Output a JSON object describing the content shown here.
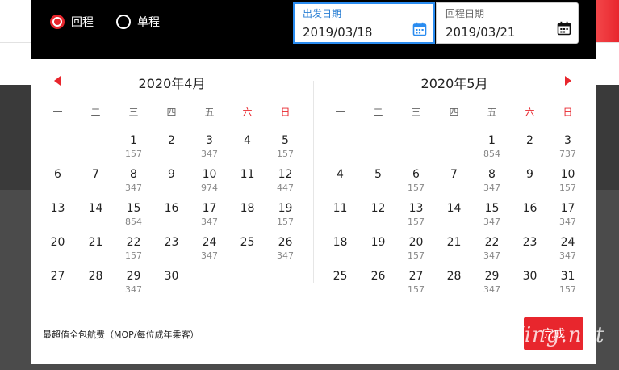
{
  "trip_type": {
    "options": [
      {
        "label": "回程",
        "checked": true
      },
      {
        "label": "单程",
        "checked": false
      }
    ]
  },
  "date_fields": {
    "depart": {
      "label": "出发日期",
      "value": "2019/03/18",
      "icon": "calendar-icon"
    },
    "return": {
      "label": "回程日期",
      "value": "2019/03/21",
      "icon": "calendar-icon"
    }
  },
  "weekdays": [
    "一",
    "二",
    "三",
    "四",
    "五",
    "六",
    "日"
  ],
  "months": [
    {
      "title": "2020年4月",
      "offset": 2,
      "days": [
        {
          "d": "1",
          "p": "157"
        },
        {
          "d": "2",
          "p": ""
        },
        {
          "d": "3",
          "p": "347"
        },
        {
          "d": "4",
          "p": ""
        },
        {
          "d": "5",
          "p": "157"
        },
        {
          "d": "6",
          "p": ""
        },
        {
          "d": "7",
          "p": ""
        },
        {
          "d": "8",
          "p": "347"
        },
        {
          "d": "9",
          "p": ""
        },
        {
          "d": "10",
          "p": "974"
        },
        {
          "d": "11",
          "p": ""
        },
        {
          "d": "12",
          "p": "447"
        },
        {
          "d": "13",
          "p": ""
        },
        {
          "d": "14",
          "p": ""
        },
        {
          "d": "15",
          "p": "854"
        },
        {
          "d": "16",
          "p": ""
        },
        {
          "d": "17",
          "p": "347"
        },
        {
          "d": "18",
          "p": ""
        },
        {
          "d": "19",
          "p": "157"
        },
        {
          "d": "20",
          "p": ""
        },
        {
          "d": "21",
          "p": ""
        },
        {
          "d": "22",
          "p": "157"
        },
        {
          "d": "23",
          "p": ""
        },
        {
          "d": "24",
          "p": "347"
        },
        {
          "d": "25",
          "p": ""
        },
        {
          "d": "26",
          "p": "347"
        },
        {
          "d": "27",
          "p": ""
        },
        {
          "d": "28",
          "p": ""
        },
        {
          "d": "29",
          "p": "347"
        },
        {
          "d": "30",
          "p": ""
        }
      ]
    },
    {
      "title": "2020年5月",
      "offset": 4,
      "days": [
        {
          "d": "1",
          "p": "854"
        },
        {
          "d": "2",
          "p": ""
        },
        {
          "d": "3",
          "p": "737"
        },
        {
          "d": "4",
          "p": ""
        },
        {
          "d": "5",
          "p": ""
        },
        {
          "d": "6",
          "p": "157"
        },
        {
          "d": "7",
          "p": ""
        },
        {
          "d": "8",
          "p": "347"
        },
        {
          "d": "9",
          "p": ""
        },
        {
          "d": "10",
          "p": "157"
        },
        {
          "d": "11",
          "p": ""
        },
        {
          "d": "12",
          "p": ""
        },
        {
          "d": "13",
          "p": "157"
        },
        {
          "d": "14",
          "p": ""
        },
        {
          "d": "15",
          "p": "347"
        },
        {
          "d": "16",
          "p": ""
        },
        {
          "d": "17",
          "p": "347"
        },
        {
          "d": "18",
          "p": ""
        },
        {
          "d": "19",
          "p": ""
        },
        {
          "d": "20",
          "p": "157"
        },
        {
          "d": "21",
          "p": ""
        },
        {
          "d": "22",
          "p": "347"
        },
        {
          "d": "23",
          "p": ""
        },
        {
          "d": "24",
          "p": "347"
        },
        {
          "d": "25",
          "p": ""
        },
        {
          "d": "26",
          "p": ""
        },
        {
          "d": "27",
          "p": "157"
        },
        {
          "d": "28",
          "p": ""
        },
        {
          "d": "29",
          "p": "347"
        },
        {
          "d": "30",
          "p": ""
        },
        {
          "d": "31",
          "p": "157"
        }
      ]
    }
  ],
  "footer": {
    "note": "最超值全包航费（MOP/每位成年乘客）",
    "done_label": "完成"
  },
  "watermark": "eLvXing.net",
  "colors": {
    "accent": "#e8262d",
    "focus": "#2a8cf0",
    "header_bg": "#000000"
  }
}
